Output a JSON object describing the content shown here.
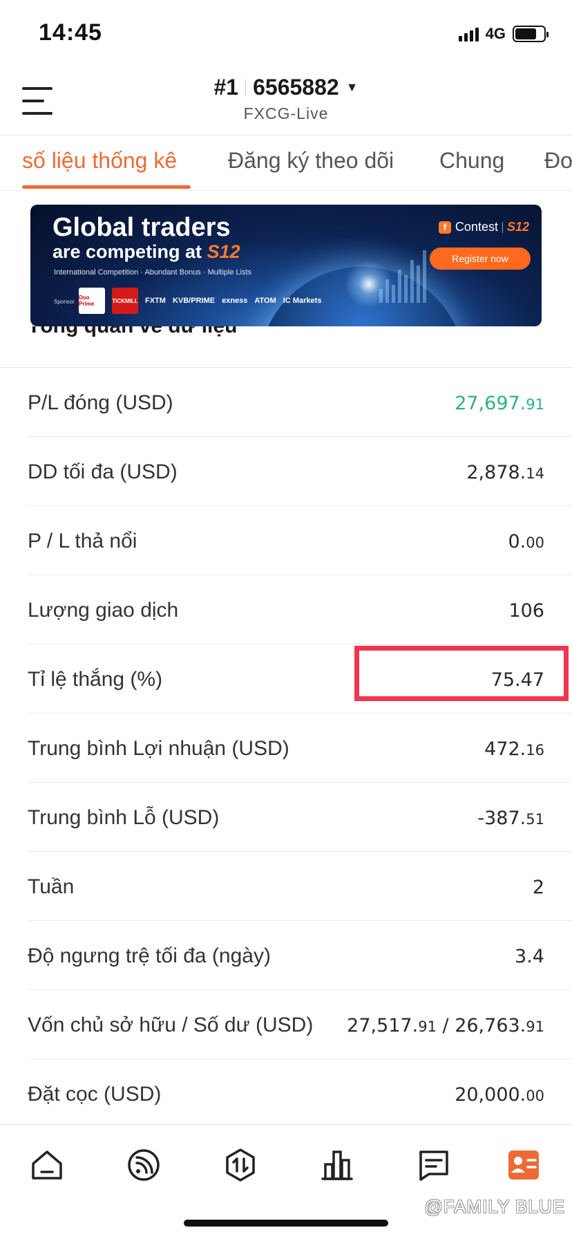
{
  "status_bar": {
    "time": "14:45",
    "network": "4G",
    "battery_level": 0.75
  },
  "header": {
    "account_number": "#1",
    "account_id": "6565882",
    "server": "FXCG-Live"
  },
  "tabs": [
    {
      "label": "số liệu thống kê",
      "active": true
    },
    {
      "label": "Đăng ký theo dõi",
      "active": false
    },
    {
      "label": "Chung",
      "active": false
    },
    {
      "label": "Đơ",
      "active": false
    }
  ],
  "banner": {
    "title_line1": "Global traders",
    "title_line2_prefix": "are competing at ",
    "title_line2_brand": "S12",
    "subtitle": "International Competition · Abundant Bonus · Multiple Lists",
    "sponsor_label": "Sponsor",
    "sponsors": [
      "Doo Prime",
      "TICKMILL",
      "FXTM",
      "KVB/PRIME",
      "exness",
      "ATOM",
      "IC Markets"
    ],
    "contest_label": "Contest",
    "contest_brand": "S12",
    "register_label": "Register now"
  },
  "section_title": "Tổng quan về dữ liệu",
  "stats": [
    {
      "label": "P/L đóng (USD)",
      "value_main": "27,697.",
      "value_frac": "91",
      "color": "#2fb08a"
    },
    {
      "label": "DD tối đa (USD)",
      "value_main": "2,878.",
      "value_frac": "14"
    },
    {
      "label": "P / L thả nổi",
      "value_main": "0.",
      "value_frac": "00"
    },
    {
      "label": "Lượng giao dịch",
      "value_main": "106",
      "value_frac": ""
    },
    {
      "label": "Tỉ lệ thắng (%)",
      "value_main": "75.47",
      "value_frac": "",
      "highlighted": true
    },
    {
      "label": "Trung bình Lợi nhuận (USD)",
      "value_main": "472.",
      "value_frac": "16"
    },
    {
      "label": "Trung bình Lỗ (USD)",
      "value_main": "-387.",
      "value_frac": "51"
    },
    {
      "label": "Tuần",
      "value_main": "2",
      "value_frac": ""
    },
    {
      "label": "Độ ngưng trệ tối đa (ngày)",
      "value_main": "3.4",
      "value_frac": ""
    },
    {
      "label": "Vốn chủ sở hữu / Số dư (USD)",
      "value_main": "27,517.",
      "value_frac": "91",
      "value_sep": " / 26,763.",
      "value_frac2": "91"
    },
    {
      "label": "Đặt cọc (USD)",
      "value_main": "20,000.",
      "value_frac": "00"
    }
  ],
  "bottom_nav": [
    {
      "icon": "home-icon",
      "active": false
    },
    {
      "icon": "signal-feed-icon",
      "active": false
    },
    {
      "icon": "trade-icon",
      "active": false
    },
    {
      "icon": "chart-icon",
      "active": false
    },
    {
      "icon": "message-icon",
      "active": false
    },
    {
      "icon": "profile-card-icon",
      "active": true
    }
  ],
  "colors": {
    "accent": "#ee6a35",
    "profit": "#2fb08a",
    "highlight_box": "#f0354e"
  },
  "watermark": "@FAMILY BLUE"
}
